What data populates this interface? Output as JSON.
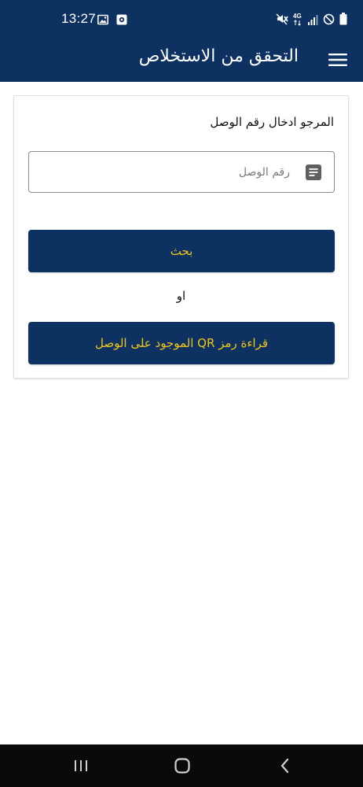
{
  "status_bar": {
    "time": "13:27",
    "left_icons": [
      "image-icon",
      "camera-app-icon"
    ],
    "right_icons": [
      "mute-icon",
      "4g-icon",
      "signal-icon",
      "dnd-icon",
      "battery-icon"
    ],
    "network_label": "4G"
  },
  "app_bar": {
    "title": "التحقق من الاستخلاص",
    "menu_icon": "menu-icon"
  },
  "form": {
    "prompt": "المرجو ادخال رقم الوصل",
    "receipt_placeholder": "رقم الوصل",
    "receipt_value": "",
    "field_icon": "document-icon",
    "search_label": "بحث",
    "or_label": "او",
    "qr_label": "قراءة رمز QR الموجود على الوصل"
  },
  "navigation": {
    "recents_icon": "recents-icon",
    "home_icon": "home-icon",
    "back_icon": "back-icon"
  },
  "colors": {
    "primary": "#0d3262",
    "accent_text": "#f2c418",
    "nav_bar": "#0a0a0a"
  }
}
